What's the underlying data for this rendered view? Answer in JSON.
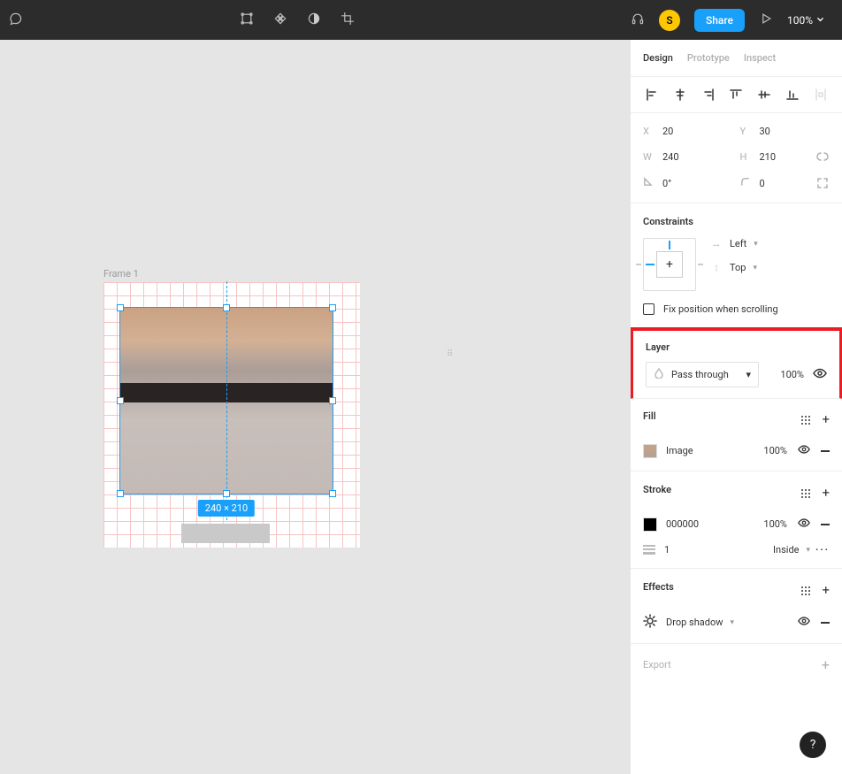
{
  "topbar": {
    "zoom": "100%",
    "share": "Share",
    "avatar_initial": "S"
  },
  "canvas": {
    "frame_label": "Frame 1",
    "dimensions_badge": "240 × 210"
  },
  "panel": {
    "tabs": {
      "design": "Design",
      "prototype": "Prototype",
      "inspect": "Inspect"
    },
    "transform": {
      "x_label": "X",
      "x": "20",
      "y_label": "Y",
      "y": "30",
      "w_label": "W",
      "w": "240",
      "h_label": "H",
      "h": "210",
      "rotation": "0°",
      "corner": "0"
    },
    "constraints": {
      "title": "Constraints",
      "horizontal": "Left",
      "vertical": "Top",
      "fix_label": "Fix position when scrolling"
    },
    "layer": {
      "title": "Layer",
      "blend_mode": "Pass through",
      "opacity": "100%"
    },
    "fill": {
      "title": "Fill",
      "type": "Image",
      "opacity": "100%"
    },
    "stroke": {
      "title": "Stroke",
      "color": "000000",
      "opacity": "100%",
      "weight": "1",
      "position": "Inside"
    },
    "effects": {
      "title": "Effects",
      "type": "Drop shadow"
    },
    "export": {
      "title": "Export"
    }
  }
}
